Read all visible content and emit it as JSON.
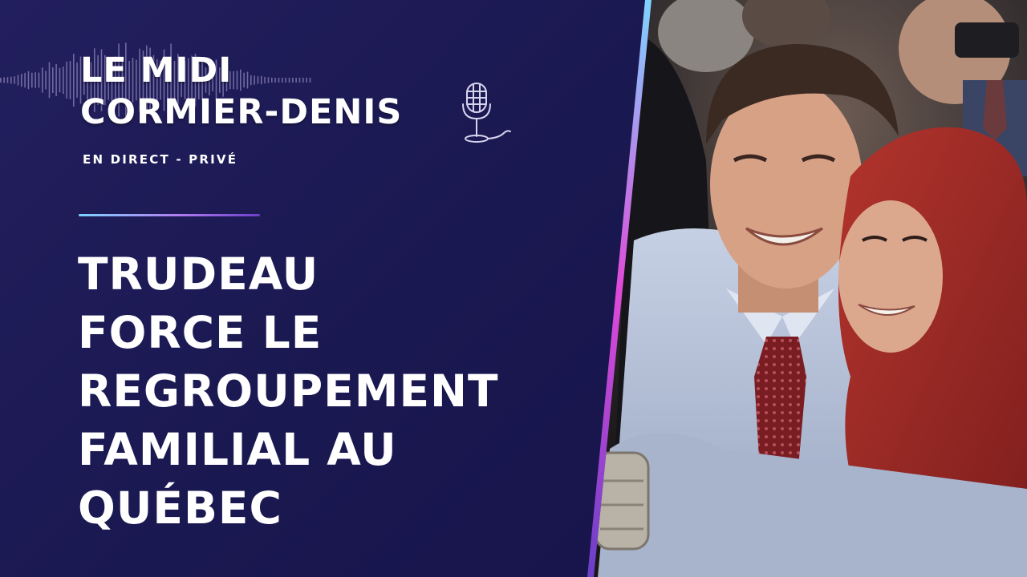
{
  "show": {
    "title_line1": "LE MIDI",
    "title_line2": "CORMIER-DENIS",
    "subtitle": "EN DIRECT - PRIVÉ"
  },
  "headline": {
    "lines": [
      "TRUDEAU",
      "FORCE LE",
      "REGROUPEMENT",
      "FAMILIAL AU",
      "QUÉBEC"
    ]
  },
  "icons": {
    "microphone": "microphone-icon",
    "waveform": "audio-waveform"
  },
  "colors": {
    "background": "#1b1850",
    "text": "#ffffff",
    "accent_cyan": "#7fd3ff",
    "accent_magenta": "#e04ad8",
    "accent_purple": "#6a3fc8",
    "hijab_red": "#a12a26"
  }
}
